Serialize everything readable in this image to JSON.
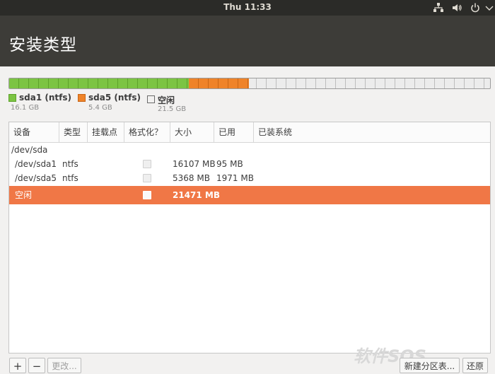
{
  "topbar": {
    "clock": "Thu 11:33"
  },
  "header": {
    "title": "安装类型"
  },
  "partition_bar": {
    "segments": [
      {
        "name": "sda1 (ntfs)",
        "size": "16.1 GB",
        "color": "#7cc443"
      },
      {
        "name": "sda5 (ntfs)",
        "size": "5.4 GB",
        "color": "#ef8329"
      },
      {
        "name": "空闲",
        "size": "21.5 GB",
        "color": "#f2f1f0"
      }
    ]
  },
  "table": {
    "columns": [
      "设备",
      "类型",
      "挂载点",
      "格式化？",
      "大小",
      "已用",
      "已装系统"
    ],
    "rows": [
      {
        "device": "/dev/sda",
        "type": "",
        "mount": "",
        "size": "",
        "used": "",
        "system": ""
      },
      {
        "device": "/dev/sda1",
        "type": "ntfs",
        "mount": "",
        "size": "16107 MB",
        "used": "95 MB",
        "system": ""
      },
      {
        "device": "/dev/sda5",
        "type": "ntfs",
        "mount": "",
        "size": "5368 MB",
        "used": "1971 MB",
        "system": ""
      },
      {
        "device": "空闲",
        "type": "",
        "mount": "",
        "size": "21471 MB",
        "used": "",
        "system": ""
      }
    ]
  },
  "toolbar": {
    "add": "+",
    "remove": "−",
    "change": "更改...",
    "new_table": "新建分区表...",
    "revert": "还原"
  },
  "watermark": "软件SOS"
}
